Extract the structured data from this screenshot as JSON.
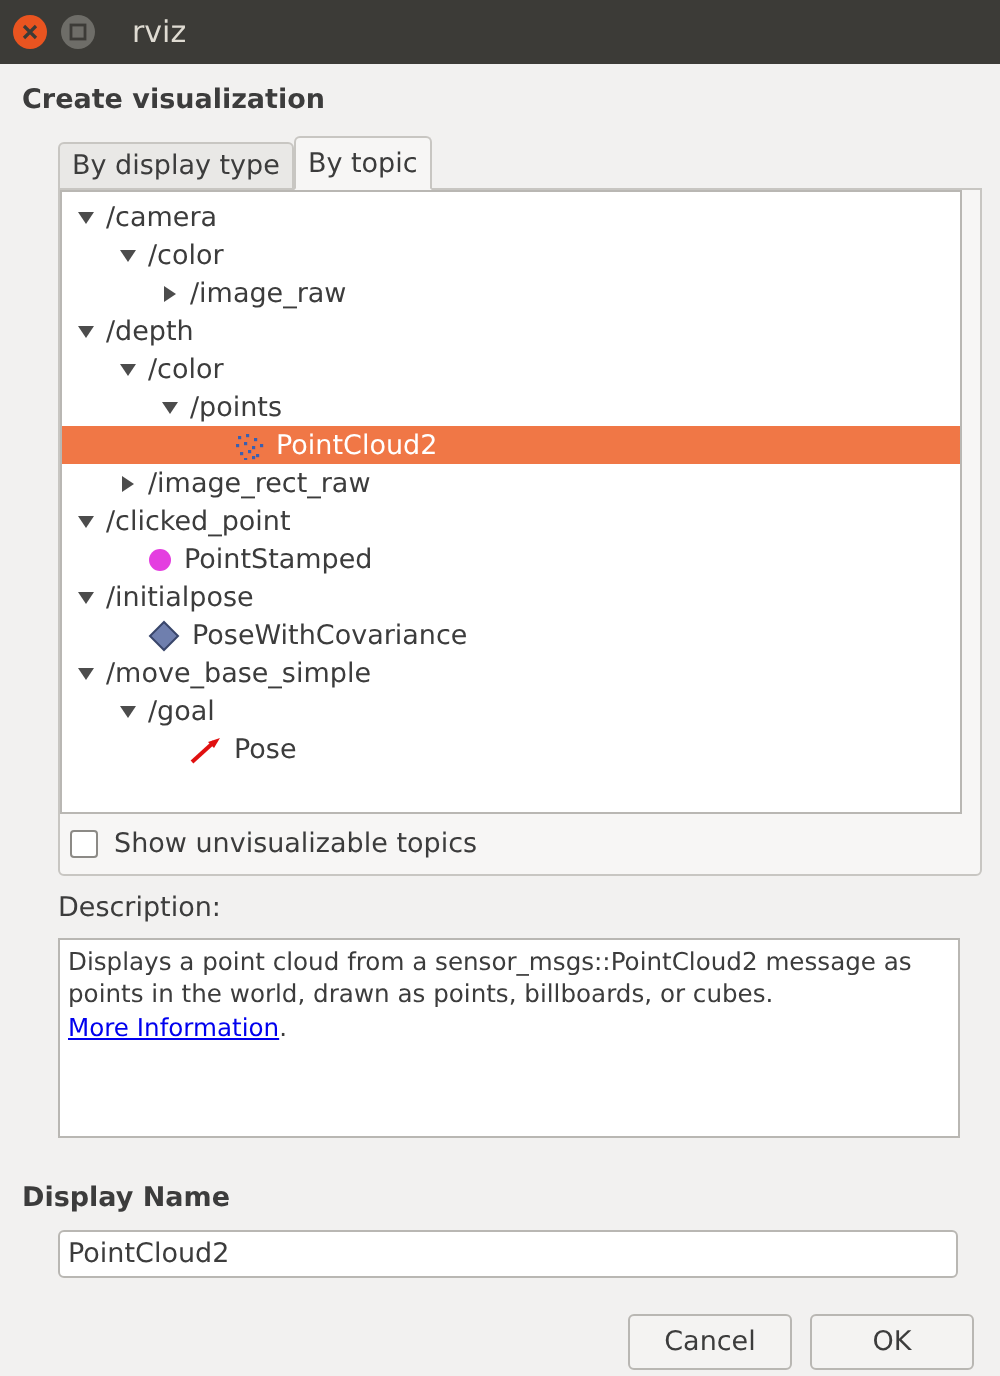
{
  "window": {
    "title": "rviz"
  },
  "heading": "Create visualization",
  "tabs": [
    {
      "label": "By display type",
      "selected": false
    },
    {
      "label": "By topic",
      "selected": true
    }
  ],
  "tree": [
    {
      "label": "/camera",
      "kind": "topic",
      "expanded": true,
      "selected": false,
      "children": [
        {
          "label": "/color",
          "kind": "topic",
          "expanded": true,
          "selected": false,
          "children": [
            {
              "label": "/image_raw",
              "kind": "topic",
              "expanded": false,
              "selected": false
            }
          ]
        }
      ]
    },
    {
      "label": "/depth",
      "kind": "topic",
      "expanded": true,
      "selected": false,
      "children": [
        {
          "label": "/color",
          "kind": "topic",
          "expanded": true,
          "selected": false,
          "children": [
            {
              "label": "/points",
              "kind": "topic",
              "expanded": true,
              "selected": false,
              "children": [
                {
                  "label": "PointCloud2",
                  "kind": "pointcloud",
                  "selected": true
                }
              ]
            }
          ]
        },
        {
          "label": "/image_rect_raw",
          "kind": "topic",
          "expanded": false,
          "selected": false
        }
      ]
    },
    {
      "label": "/clicked_point",
      "kind": "topic",
      "expanded": true,
      "selected": false,
      "children": [
        {
          "label": "PointStamped",
          "kind": "point",
          "selected": false
        }
      ]
    },
    {
      "label": "/initialpose",
      "kind": "topic",
      "expanded": true,
      "selected": false,
      "children": [
        {
          "label": "PoseWithCovariance",
          "kind": "pose_covariance",
          "selected": false
        }
      ]
    },
    {
      "label": "/move_base_simple",
      "kind": "topic",
      "expanded": true,
      "selected": false,
      "children": [
        {
          "label": "/goal",
          "kind": "topic",
          "expanded": true,
          "selected": false,
          "children": [
            {
              "label": "Pose",
              "kind": "pose",
              "selected": false
            }
          ]
        }
      ]
    }
  ],
  "show_unvisualizable": {
    "label": "Show unvisualizable topics",
    "checked": false
  },
  "description": {
    "label": "Description:",
    "text": "Displays a point cloud from a sensor_msgs::PointCloud2 message as points in the world, drawn as points, billboards, or cubes.",
    "link": "More Information",
    "after": "."
  },
  "display_name": {
    "label": "Display Name",
    "value": "PointCloud2"
  },
  "buttons": [
    "Cancel",
    "OK"
  ]
}
